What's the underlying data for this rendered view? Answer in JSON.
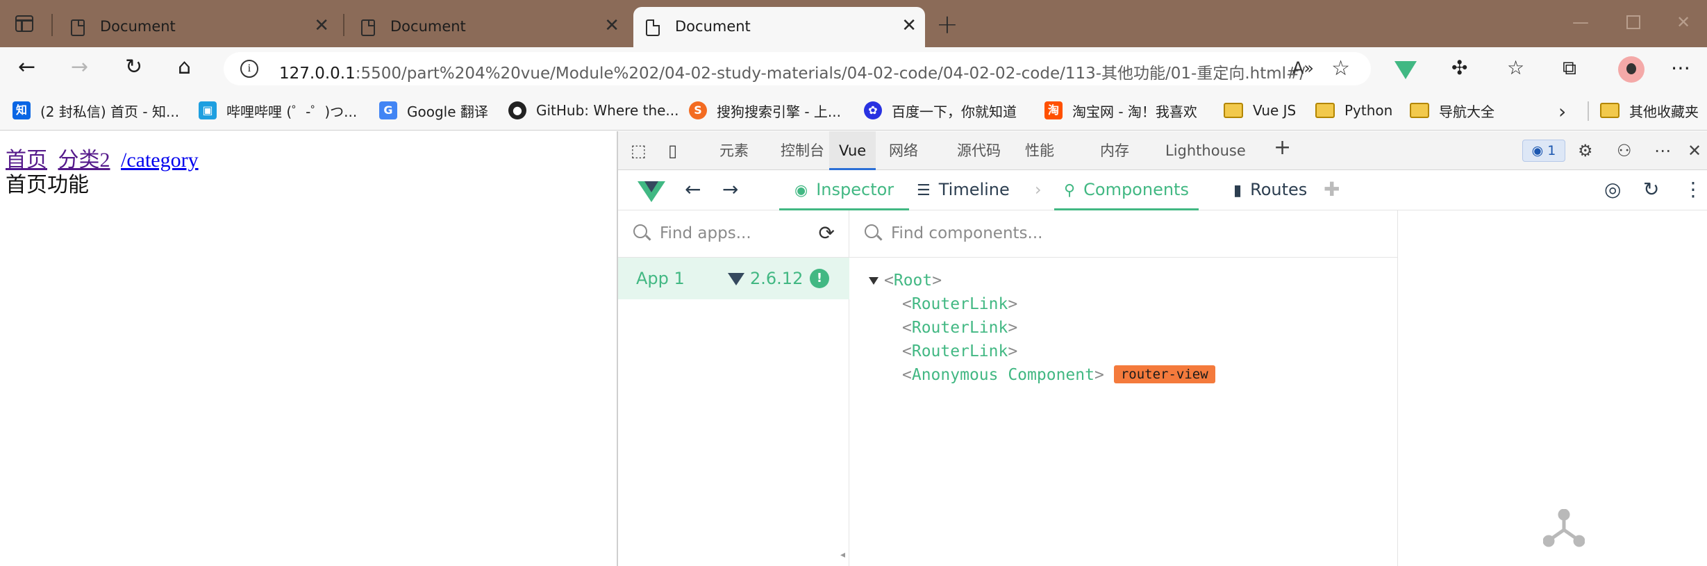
{
  "browser": {
    "tabs": [
      {
        "title": "Document",
        "active": false
      },
      {
        "title": "Document",
        "active": false
      },
      {
        "title": "Document",
        "active": true
      }
    ],
    "window_controls": [
      "minimize",
      "maximize",
      "close"
    ],
    "url_host": "127.0.0.1",
    "url_rest": ":5500/part%204%20vue/Module%202/04-02-study-materials/04-02-code/04-02-02-code/113-其他功能/01-重定向.html#/",
    "bookmarks": [
      {
        "label": "(2 封私信) 首页 - 知...",
        "icon": "zhihu-icon",
        "color": "#0a66e4"
      },
      {
        "label": "哔哩哔哩 (゜-゜)つ...",
        "icon": "bilibili-icon",
        "color": "#1e9fe0"
      },
      {
        "label": "Google 翻译",
        "icon": "google-translate-icon",
        "color": "#4285f4"
      },
      {
        "label": "GitHub: Where the...",
        "icon": "github-icon",
        "color": "#222222"
      },
      {
        "label": "搜狗搜索引擎 - 上...",
        "icon": "sogou-icon",
        "color": "#f36b21"
      },
      {
        "label": "百度一下，你就知道",
        "icon": "baidu-icon",
        "color": "#2932e1"
      },
      {
        "label": "淘宝网 - 淘！我喜欢",
        "icon": "taobao-icon",
        "color": "#ff5000"
      },
      {
        "label": "Vue JS",
        "icon": "folder-icon"
      },
      {
        "label": "Python",
        "icon": "folder-icon"
      },
      {
        "label": "导航大全",
        "icon": "folder-icon"
      }
    ],
    "other_bookmarks": "其他收藏夹"
  },
  "page": {
    "links": [
      "首页",
      "分类2",
      "/category"
    ],
    "content": "首页功能"
  },
  "devtools": {
    "tabs": [
      "元素",
      "控制台",
      "Vue",
      "网络",
      "源代码",
      "性能",
      "内存",
      "Lighthouse"
    ],
    "active_tab": "Vue",
    "message_count": "1"
  },
  "vue_devtools": {
    "nav": {
      "inspector": "Inspector",
      "timeline": "Timeline",
      "components": "Components",
      "routes": "Routes"
    },
    "apps_search_placeholder": "Find apps...",
    "components_search_placeholder": "Find components...",
    "app": {
      "name": "App 1",
      "version": "2.6.12",
      "warn": "!"
    },
    "tree": [
      {
        "open": "<",
        "name": "Root",
        "close": ">"
      },
      {
        "open": "<",
        "name": "RouterLink",
        "close": ">"
      },
      {
        "open": "<",
        "name": "RouterLink",
        "close": ">"
      },
      {
        "open": "<",
        "name": "RouterLink",
        "close": ">"
      },
      {
        "open": "<",
        "name": "Anonymous Component",
        "close": ">",
        "badge": "router-view"
      }
    ],
    "accent_color": "#42b883",
    "badge_color": "#f47a3c"
  }
}
